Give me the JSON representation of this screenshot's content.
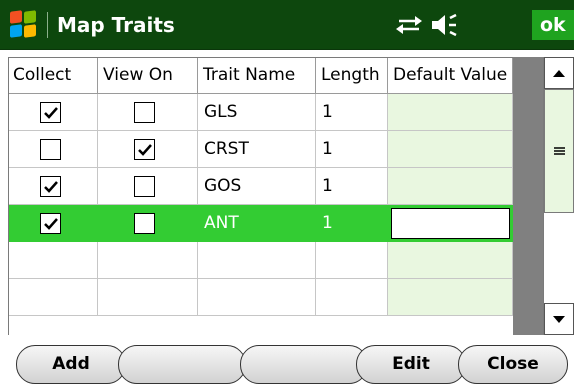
{
  "titlebar": {
    "title": "Map Traits",
    "ok_label": "ok",
    "icons": [
      "windows-logo",
      "connectivity-arrows",
      "speaker-volume"
    ]
  },
  "grid": {
    "columns": [
      "Collect",
      "View On",
      "Trait Name",
      "Length",
      "Default Value"
    ],
    "rows": [
      {
        "collect": true,
        "view_on": false,
        "trait_name": "GLS",
        "length": "1",
        "default_value": ""
      },
      {
        "collect": false,
        "view_on": true,
        "trait_name": "CRST",
        "length": "1",
        "default_value": ""
      },
      {
        "collect": true,
        "view_on": false,
        "trait_name": "GOS",
        "length": "1",
        "default_value": ""
      },
      {
        "collect": true,
        "view_on": false,
        "trait_name": "ANT",
        "length": "1",
        "default_value": "",
        "selected": true
      }
    ]
  },
  "toolbar": {
    "add_label": "Add",
    "blank1_label": "",
    "blank2_label": "",
    "edit_label": "Edit",
    "close_label": "Close"
  },
  "colors": {
    "titlebar_bg": "#0d470d",
    "selected_row": "#33cc33",
    "ok_button": "#1fa31f",
    "default_col_bg": "#e9f7e0"
  }
}
